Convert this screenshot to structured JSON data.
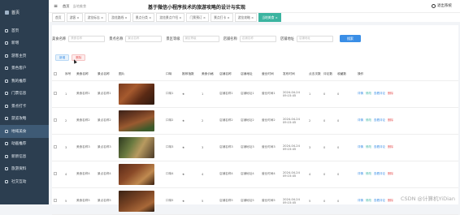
{
  "sidebar": {
    "logo": "首页",
    "items": [
      {
        "label": "首页"
      },
      {
        "label": "新增"
      },
      {
        "label": "游客主页"
      },
      {
        "label": "景色客户"
      },
      {
        "label": "我的推荐"
      },
      {
        "label": "门票信息"
      },
      {
        "label": "景点打卡"
      },
      {
        "label": "游览攻略"
      },
      {
        "label": "地域美食"
      },
      {
        "label": "动画推荐"
      },
      {
        "label": "新新信息"
      },
      {
        "label": "旅游资料"
      },
      {
        "label": "社交互动"
      }
    ]
  },
  "header": {
    "breadcrumb_home": "首页",
    "breadcrumb_current": "当地美食",
    "title": "基于微信小程序技术的旅游攻略的设计与实现",
    "user_label": "退出系统"
  },
  "tags": [
    "首页",
    "游客 ×",
    "游览标志 ×",
    "游览路线 ×",
    "景点分类 ×",
    "游览景点介绍 ×",
    "门票预订 ×",
    "景点打卡 ×",
    "游览攻略 ×",
    "当地美食 ×"
  ],
  "search": {
    "fields": [
      {
        "label": "美食名称",
        "placeholder": "美食名称"
      },
      {
        "label": "景点名称",
        "placeholder": "景点名称"
      },
      {
        "label": "景区等级",
        "placeholder": "景区等级"
      },
      {
        "label": "店铺名称",
        "placeholder": "店铺名称"
      },
      {
        "label": "店铺地址",
        "placeholder": "店铺地址"
      }
    ],
    "button": "搜索"
  },
  "actions": {
    "add": "新增",
    "delete": "删除"
  },
  "table": {
    "headers": [
      "",
      "序号",
      "美食名称",
      "景点名称",
      "图片",
      "",
      "口味",
      "推荐指数",
      "美食价格",
      "店铺名称",
      "店铺地址",
      "营业时间",
      "发布时间",
      "点击次数",
      "评论数",
      "收藏数",
      "",
      "操作"
    ],
    "rows": [
      {
        "no": "1",
        "food": "美食名称1",
        "spot": "景点名称1",
        "taste": "口味1",
        "rec": "★",
        "price": "1",
        "shop": "店铺名称1",
        "addr": "店铺地址1",
        "hours": "营业时间1",
        "date": "2024-04-24",
        "time": "09:15:45",
        "clicks": "1",
        "comments": "0",
        "favs": "0"
      },
      {
        "no": "2",
        "food": "美食名称2",
        "spot": "景点名称2",
        "taste": "口味2",
        "rec": "★",
        "price": "2",
        "shop": "店铺名称2",
        "addr": "店铺地址2",
        "hours": "营业时间2",
        "date": "2024-04-24",
        "time": "09:15:45",
        "clicks": "2",
        "comments": "0",
        "favs": "0"
      },
      {
        "no": "3",
        "food": "美食名称3",
        "spot": "景点名称3",
        "taste": "口味3",
        "rec": "★",
        "price": "3",
        "shop": "店铺名称3",
        "addr": "店铺地址3",
        "hours": "营业时间3",
        "date": "2024-04-24",
        "time": "09:15:45",
        "clicks": "3",
        "comments": "0",
        "favs": "0"
      },
      {
        "no": "4",
        "food": "美食名称4",
        "spot": "景点名称4",
        "taste": "口味4",
        "rec": "★",
        "price": "4",
        "shop": "店铺名称4",
        "addr": "店铺地址4",
        "hours": "营业时间4",
        "date": "2024-04-24",
        "time": "09:15:45",
        "clicks": "4",
        "comments": "0",
        "favs": "0"
      },
      {
        "no": "5",
        "food": "美食名称5",
        "spot": "景点名称5",
        "taste": "口味5",
        "rec": "★",
        "price": "5",
        "shop": "店铺名称5",
        "addr": "店铺地址5",
        "hours": "营业时间5",
        "date": "2024-04-24",
        "time": "09:15:45",
        "clicks": "5",
        "comments": "0",
        "favs": "0"
      }
    ],
    "ops": {
      "view": "详情",
      "edit": "修改",
      "comments": "查看评论",
      "delete": "删除"
    }
  },
  "watermark": "CSDN @计算机YiDian",
  "colors": {
    "sidebar_bg": "#2c3e50",
    "primary": "#3a8ee6",
    "active_tag": "#3bb4a0",
    "danger": "#e65555"
  }
}
